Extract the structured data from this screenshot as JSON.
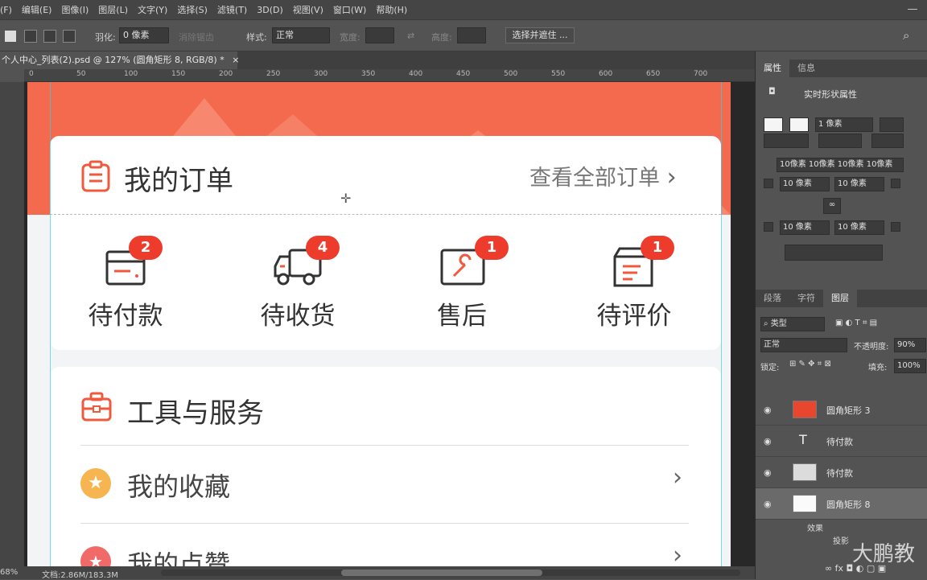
{
  "menu": [
    "(F)",
    "编辑(E)",
    "图像(I)",
    "图层(L)",
    "文字(Y)",
    "选择(S)",
    "滤镜(T)",
    "3D(D)",
    "视图(V)",
    "窗口(W)",
    "帮助(H)"
  ],
  "options": {
    "feather_label": "羽化:",
    "feather_value": "0 像素",
    "antialias_label": "消除锯齿",
    "style_label": "样式:",
    "style_value": "正常",
    "width_label": "宽度:",
    "height_label": "高度:",
    "select_mask_button": "选择并遮住 ..."
  },
  "document_tab": {
    "title": "个人中心_列表(2).psd @ 127% (圆角矩形 8, RGB/8) *",
    "close": "×"
  },
  "ruler_ticks": [
    "0",
    "50",
    "100",
    "150",
    "200",
    "250",
    "300",
    "350",
    "400",
    "450",
    "500",
    "550",
    "600",
    "650",
    "700"
  ],
  "canvas": {
    "order_card": {
      "title": "我的订单",
      "view_all": "查看全部订单",
      "items": [
        {
          "label": "待付款",
          "badge": "2",
          "icon": "wallet-icon"
        },
        {
          "label": "待收货",
          "badge": "4",
          "icon": "truck-icon"
        },
        {
          "label": "售后",
          "badge": "1",
          "icon": "wrench-icon"
        },
        {
          "label": "待评价",
          "badge": "1",
          "icon": "review-icon"
        }
      ]
    },
    "tools_card": {
      "title": "工具与服务",
      "rows": [
        {
          "label": "我的收藏",
          "icon": "star-icon"
        },
        {
          "label": "我的点赞",
          "icon": "like-icon"
        }
      ]
    }
  },
  "status": {
    "zoom": "68%",
    "doc": "文档:2.86M/183.3M"
  },
  "properties_panel": {
    "tabs": [
      "属性",
      "信息"
    ],
    "shape_title": "实时形状属性",
    "stroke_width": "1 像素",
    "radius_all": "10像素 10像素 10像素 10像素",
    "r1": "10 像素",
    "r2": "10 像素",
    "r3": "10 像素",
    "r4": "10 像素"
  },
  "layers_panel": {
    "tabs": [
      "段落",
      "字符",
      "图层"
    ],
    "filter": "类型",
    "blend_mode": "正常",
    "opacity_label": "不透明度:",
    "opacity_value": "90%",
    "lock_label": "锁定:",
    "fill_label": "填充:",
    "fill_value": "100%",
    "layers": [
      {
        "name": "圆角矩形 3",
        "thumb": "red-rect"
      },
      {
        "name": "待付款",
        "thumb": "text"
      },
      {
        "name": "待付款",
        "thumb": "group"
      },
      {
        "name": "圆角矩形 8",
        "thumb": "white-rect"
      }
    ],
    "effects_label": "效果",
    "shadow_label": "投影"
  },
  "watermark": "大鹏教"
}
